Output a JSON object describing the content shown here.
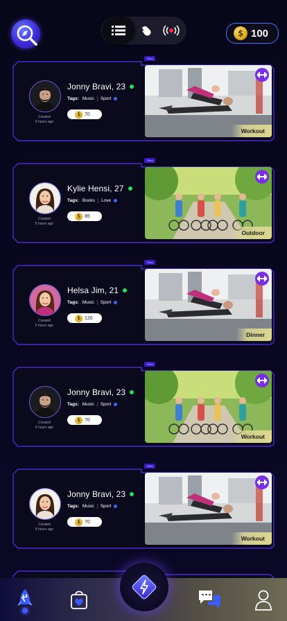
{
  "header": {
    "search_icon": "search-compass-icon",
    "view_toggle": [
      {
        "name": "list-view-icon",
        "active": true
      },
      {
        "name": "swipe-hand-icon",
        "active": false
      },
      {
        "name": "live-broadcast-icon",
        "active": false
      }
    ],
    "coins": {
      "value": "100",
      "icon": "coin-dollar-icon"
    }
  },
  "cards": [
    {
      "tag": "Titles",
      "name": "Jonny Bravi, 23",
      "online": true,
      "tags_label": "Tags:",
      "tags": [
        "Music",
        "Sport"
      ],
      "price": "70",
      "created": "Created\n5 hours ago",
      "category": "Workout",
      "category_icon": "dumbbell-icon",
      "avatar": "male-dark",
      "photo": "gym"
    },
    {
      "tag": "Titles",
      "name": "Kylie Hensi, 27",
      "online": true,
      "tags_label": "Tags:",
      "tags": [
        "Books",
        "Love"
      ],
      "price": "85",
      "created": "Created\n6 hours ago",
      "category": "Outdoor",
      "category_icon": "dumbbell-icon",
      "avatar": "female-light",
      "photo": "park"
    },
    {
      "tag": "Titles",
      "name": "Helsa Jim, 21",
      "online": true,
      "tags_label": "Tags:",
      "tags": [
        "Music",
        "Sport"
      ],
      "price": "120",
      "created": "Created\n5 hours ago",
      "category": "Dinner",
      "category_icon": "dumbbell-icon",
      "avatar": "female-pink",
      "photo": "gym"
    },
    {
      "tag": "Titles",
      "name": "Jonny Bravi, 23",
      "online": true,
      "tags_label": "Tags:",
      "tags": [
        "Music",
        "Sport"
      ],
      "price": "70",
      "created": "Created\n5 hours ago",
      "category": "Workout",
      "category_icon": "dumbbell-icon",
      "avatar": "male-dark",
      "photo": "park"
    },
    {
      "tag": "Titles",
      "name": "Jonny Bravi, 23",
      "online": true,
      "tags_label": "Tags:",
      "tags": [
        "Music",
        "Sport"
      ],
      "price": "70",
      "created": "Created\n5 hours ago",
      "category": "Workout",
      "category_icon": "dumbbell-icon",
      "avatar": "female-light",
      "photo": "gym"
    }
  ],
  "bottom_nav": [
    {
      "name": "rocket-icon",
      "active": true
    },
    {
      "name": "shopping-bag-heart-icon",
      "active": false
    },
    {
      "name": "center-bolt-icon",
      "active": false
    },
    {
      "name": "chat-bubbles-icon",
      "active": false
    },
    {
      "name": "profile-icon",
      "active": false
    }
  ],
  "colors": {
    "accent": "#3b1bc4",
    "frame": "#4a2bd0",
    "online": "#22e35a",
    "coin": "#d3a114",
    "category_bg": "#dcd68f"
  }
}
